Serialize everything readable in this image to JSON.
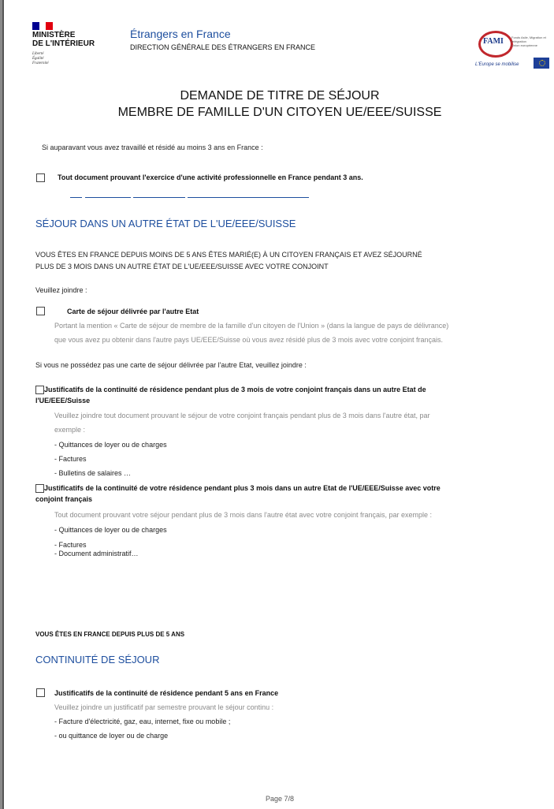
{
  "header": {
    "flag_colors": [
      "#000091",
      "#ffffff",
      "#e1000f"
    ],
    "ministry_line1": "MINISTÈRE",
    "ministry_line2": "DE L'INTÉRIEUR",
    "motto_1": "Liberté",
    "motto_2": "Égalité",
    "motto_3": "Fraternité",
    "site_title": "Étrangers en France",
    "site_subtitle": "DIRECTION GÉNÉRALE DES ÉTRANGERS EN FRANCE",
    "fami_logo": "FAMI",
    "fami_small": "Fonds Asile, Migration et Intégration",
    "fami_union": "Union européenne",
    "fami_slogan": "L'Europe se mobilise"
  },
  "title": {
    "line1": "DEMANDE DE TITRE DE SÉJOUR",
    "line2": "MEMBRE DE FAMILLE D'UN CITOYEN UE/EEE/SUISSE"
  },
  "intro": {
    "text": "Si auparavant vous avez travaillé et résidé au moins 3 ans en France :",
    "item1": "Tout document prouvant l'exercice d'une activité professionnelle en France pendant 3 ans."
  },
  "section1": {
    "heading": "SÉJOUR DANS UN AUTRE ÉTAT DE L'UE/EEE/SUISSE",
    "condition_1": "VOUS ÊTES EN FRANCE DEPUIS MOINS DE 5 ANS ÊTES MARIÉ(E) À UN CITOYEN FRANÇAIS ET AVEZ SÉJOURNÉ",
    "condition_2": "PLUS DE 3 MOIS DANS UN AUTRE ÉTAT DE L'UE/EEE/SUISSE AVEC VOTRE CONJOINT",
    "join": "Veuillez joindre :",
    "item_card": "Carte de séjour délivrée par l'autre Etat",
    "card_desc_1": "Portant la mention « Carte de séjour de membre de la famille d'un citoyen de l'Union » (dans la langue de pays de délivrance)",
    "card_desc_2": "que vous avez pu obtenir dans l'autre pays UE/EEE/Suisse où vous avez résidé plus de 3 mois avec votre conjoint français.",
    "if_not": "Si vous ne possédez pas une carte de séjour délivrée par l'autre Etat, veuillez joindre :",
    "item_a_1": "Justificatifs de la continuité de résidence pendant plus de 3 mois de votre conjoint français dans un autre Etat de",
    "item_a_2": "l'UE/EEE/Suisse",
    "item_a_desc_1": "Veuillez joindre tout document prouvant le séjour de votre conjoint français pendant plus de 3 mois dans l'autre état, par",
    "item_a_desc_2": "exemple :",
    "item_a_list": [
      "- Quittances de loyer ou de charges",
      "- Factures",
      "- Bulletins de salaires …"
    ],
    "item_b_1": "Justificatifs de la continuité de votre résidence pendant plus 3 mois dans un autre Etat de l'UE/EEE/Suisse avec votre",
    "item_b_2": "conjoint français",
    "item_b_desc": "Tout document prouvant votre séjour pendant plus de 3 mois dans l'autre état avec votre conjoint français, par exemple :",
    "item_b_list": [
      "- Quittances de loyer ou de charges",
      "- Factures",
      "- Document administratif…"
    ]
  },
  "section2": {
    "condition": "VOUS ÊTES EN FRANCE DEPUIS PLUS DE 5 ANS",
    "heading": "CONTINUITÉ DE SÉJOUR",
    "item": "Justificatifs de la continuité de résidence pendant 5 ans en France",
    "desc": "Veuillez joindre un justificatif par semestre prouvant le séjour continu :",
    "list": [
      "- Facture d'électricité, gaz, eau, internet, fixe ou mobile ;",
      "- ou quittance de loyer ou de charge"
    ]
  },
  "footer": {
    "page": "Page 7/8"
  }
}
